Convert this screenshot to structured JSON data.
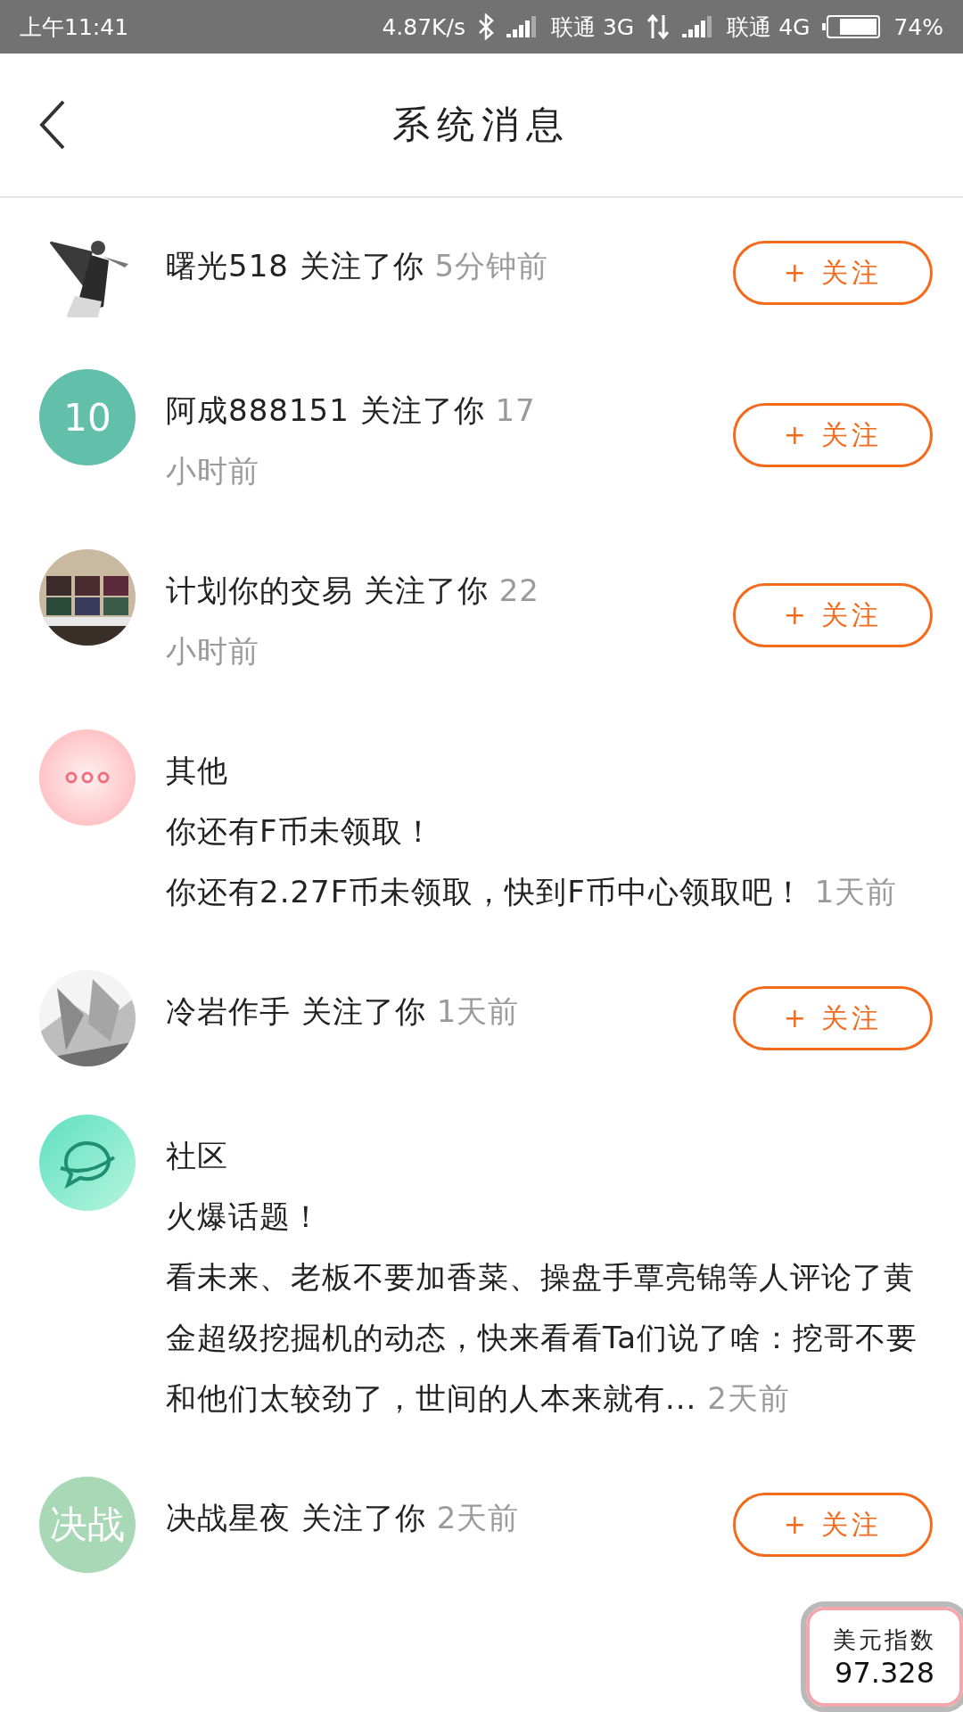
{
  "status_bar": {
    "time": "上午11:41",
    "speed": "4.87K/s",
    "carrier_1": "联通 3G",
    "carrier_2": "联通 4G",
    "battery": "74%"
  },
  "header": {
    "title": "系统消息"
  },
  "messages": [
    {
      "kind": "follow",
      "text": "曙光518 关注了你",
      "time": "5分钟前",
      "button": "+ 关注"
    },
    {
      "kind": "follow",
      "avatar": {
        "kind": "label",
        "text": "10",
        "color": "#62bfa9"
      },
      "text": "阿成888151 关注了你",
      "time": "17小时前",
      "button": "+ 关注"
    },
    {
      "kind": "follow",
      "text": "计划你的交易 关注了你",
      "time": "22小时前",
      "button": "+ 关注"
    },
    {
      "kind": "notice",
      "avatar": {
        "kind": "dots"
      },
      "category": "其他",
      "title": "你还有F币未领取！",
      "text": "你还有2.27F币未领取，快到F币中心领取吧！",
      "time": "1天前"
    },
    {
      "kind": "follow",
      "text": "冷岩作手 关注了你",
      "time": "1天前",
      "button": "+ 关注"
    },
    {
      "kind": "notice",
      "avatar": {
        "kind": "chat"
      },
      "category": "社区",
      "title": "火爆话题！",
      "text": "看未来、老板不要加香菜、操盘手覃亮锦等人评论了黄金超级挖掘机的动态，快来看看Ta们说了啥：挖哥不要和他们太较劲了，世间的人本来就有...",
      "time": "2天前"
    },
    {
      "kind": "follow",
      "avatar": {
        "kind": "label",
        "text": "决战",
        "color": "#a8d8b6"
      },
      "text": "决战星夜 关注了你",
      "time": "2天前",
      "button": "+ 关注"
    }
  ],
  "widget": {
    "label": "美元指数",
    "value": "97.328"
  }
}
